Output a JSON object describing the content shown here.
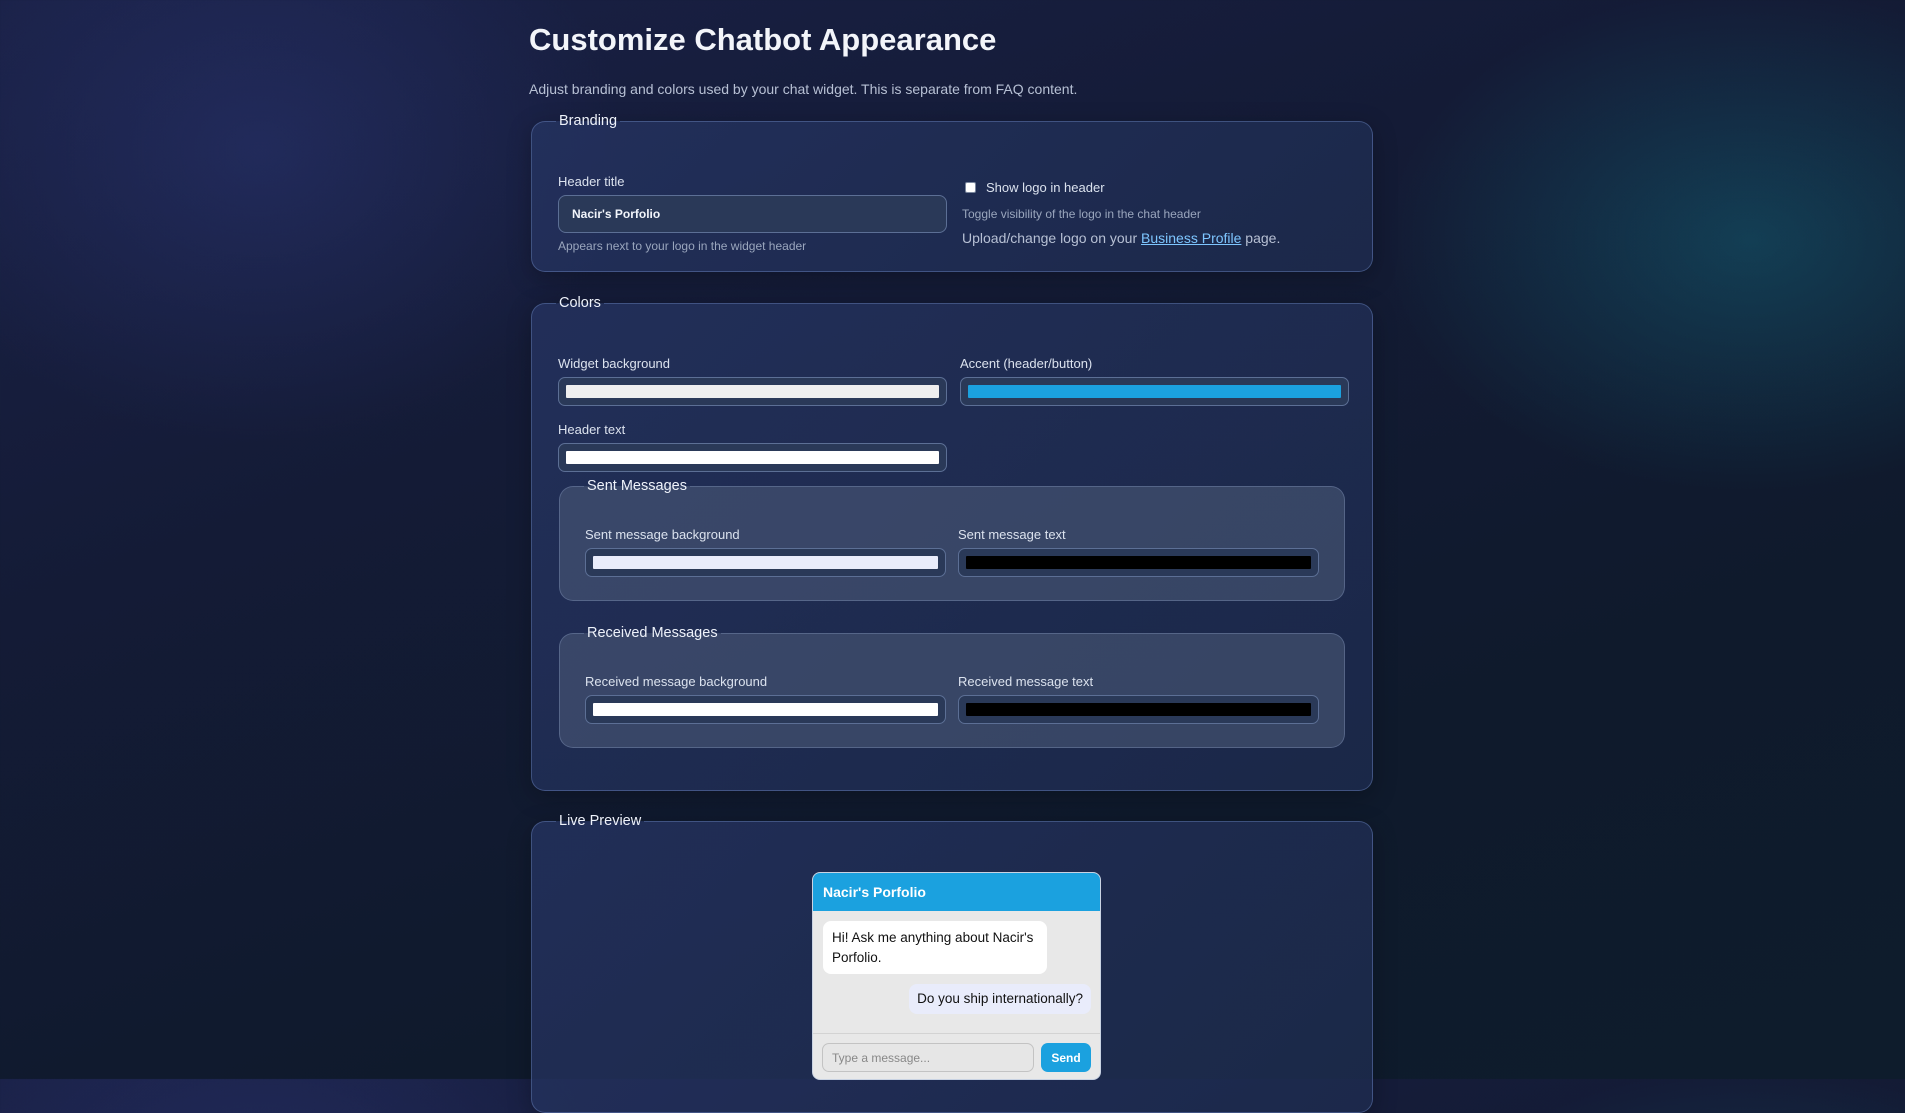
{
  "page": {
    "title": "Customize Chatbot Appearance",
    "subtitle": "Adjust branding and colors used by your chat widget. This is separate from FAQ content."
  },
  "branding": {
    "legend": "Branding",
    "header_title_label": "Header title",
    "header_title_value": "Nacir's Porfolio",
    "header_title_hint": "Appears next to your logo in the widget header",
    "show_logo_label": "Show logo in header",
    "show_logo_checked": false,
    "show_logo_hint": "Toggle visibility of the logo in the chat header",
    "upload_text_before": "Upload/change logo on your ",
    "upload_link_text": "Business Profile",
    "upload_text_after": " page."
  },
  "colors": {
    "legend": "Colors",
    "widget_background_label": "Widget background",
    "widget_background_value": "#eeeeee",
    "accent_label": "Accent (header/button)",
    "accent_value": "#1ba1df",
    "header_text_label": "Header text",
    "header_text_value": "#ffffff",
    "sent": {
      "legend": "Sent Messages",
      "background_label": "Sent message background",
      "background_value": "#e9ecfb",
      "text_label": "Sent message text",
      "text_value": "#000000"
    },
    "received": {
      "legend": "Received Messages",
      "background_label": "Received message background",
      "background_value": "#ffffff",
      "text_label": "Received message text",
      "text_value": "#000000"
    }
  },
  "preview": {
    "legend": "Live Preview",
    "header_title": "Nacir's Porfolio",
    "received_message": "Hi! Ask me anything about Nacir's Porfolio.",
    "sent_message": "Do you ship internationally?",
    "input_placeholder": "Type a message...",
    "send_label": "Send"
  }
}
